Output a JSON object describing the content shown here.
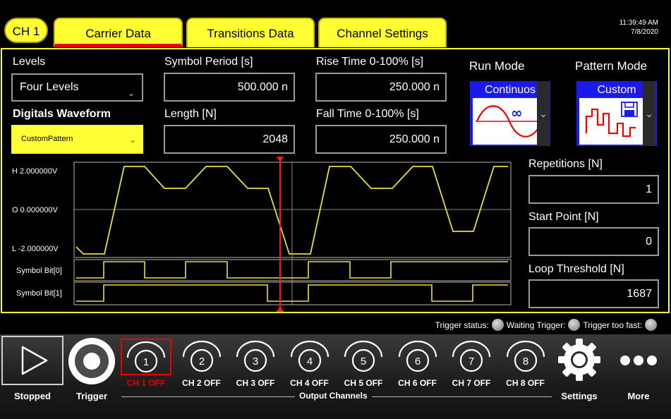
{
  "tabs": {
    "channel": "CH 1",
    "carrier": "Carrier Data",
    "transitions": "Transitions Data",
    "channel_settings": "Channel Settings"
  },
  "clock": {
    "time": "11:39:49 AM",
    "date": "7/8/2020"
  },
  "levels": {
    "label": "Levels",
    "value": "Four Levels"
  },
  "digitals": {
    "label": "Digitals Waveform",
    "value": "CustomPattern"
  },
  "symbol_period": {
    "label": "Symbol Period [s]",
    "value": "500.000 n"
  },
  "length": {
    "label": "Length [N]",
    "value": "2048"
  },
  "rise_time": {
    "label": "Rise Time 0-100% [s]",
    "value": "250.000 n"
  },
  "fall_time": {
    "label": "Fall Time 0-100% [s]",
    "value": "250.000 n"
  },
  "run_mode": {
    "label": "Run Mode",
    "value": "Continuos"
  },
  "pattern_mode": {
    "label": "Pattern Mode",
    "value": "Custom"
  },
  "repetitions": {
    "label": "Repetitions [N]",
    "value": "1"
  },
  "start_point": {
    "label": "Start Point [N]",
    "value": "0"
  },
  "loop_threshold": {
    "label": "Loop Threshold [N]",
    "value": "1687"
  },
  "waveform": {
    "h_label": "H  2.000000V",
    "o_label": "O  0.000000V",
    "l_label": "L  -2.000000V",
    "bit0_label": "Symbol Bit[0]",
    "bit1_label": "Symbol Bit[1]",
    "colors": {
      "trace": "#e8e03a",
      "cursor": "#ff1a1a",
      "frame": "#ffff33"
    },
    "marker_position": 0.49
  },
  "trigger_status": {
    "status_label": "Trigger status:",
    "waiting_label": "Waiting Trigger:",
    "too_fast_label": "Trigger too fast:"
  },
  "bottom": {
    "stopped": "Stopped",
    "trigger": "Trigger",
    "output_channels": "Output Channels",
    "settings": "Settings",
    "more": "More",
    "channels": [
      {
        "num": "1",
        "label": "CH 1 OFF",
        "selected": true
      },
      {
        "num": "2",
        "label": "CH 2 OFF"
      },
      {
        "num": "3",
        "label": "CH 3 OFF"
      },
      {
        "num": "4",
        "label": "CH 4 OFF"
      },
      {
        "num": "5",
        "label": "CH 5 OFF"
      },
      {
        "num": "6",
        "label": "CH 6 OFF"
      },
      {
        "num": "7",
        "label": "CH 7 OFF"
      },
      {
        "num": "8",
        "label": "CH 8 OFF"
      }
    ]
  },
  "accent": {
    "yellow": "#ffff33",
    "red": "#e00000"
  }
}
